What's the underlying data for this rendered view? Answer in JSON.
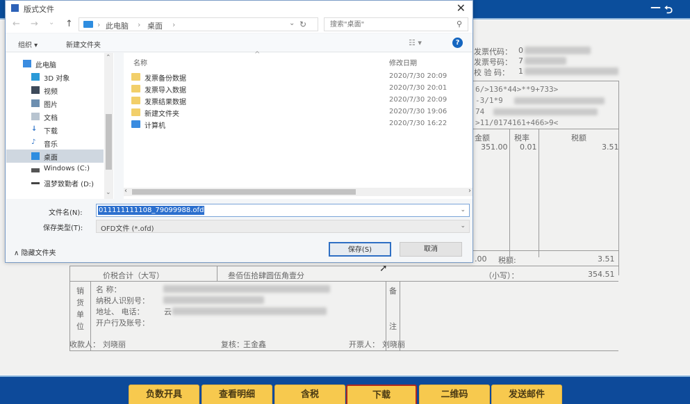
{
  "app": {
    "window_controls": {
      "minimize": "—",
      "back": "⮌"
    },
    "bottom_buttons": [
      {
        "label": "负数开具",
        "active": false
      },
      {
        "label": "查看明细",
        "active": false
      },
      {
        "label": "含税",
        "active": false
      },
      {
        "label": "下载",
        "active": true
      },
      {
        "label": "二维码",
        "active": false
      },
      {
        "label": "发送邮件",
        "active": false
      }
    ],
    "colors": {
      "topbar": "#0b4e9c",
      "button": "#f7c94e",
      "active_border": "#b0281e"
    }
  },
  "invoice": {
    "code_label": "发票代码：",
    "code_value": "0",
    "number_label": "发票号码：",
    "number_value": "7",
    "check_label": "校 验 码：",
    "check_value": "1",
    "cipher_lines": [
      "6/>136*44>**9+733>",
      "-3/1*9",
      "74",
      ">11/0174161+466>9<"
    ],
    "table_headers": {
      "amount": "金额",
      "rate": "税率",
      "tax": "税额"
    },
    "row": {
      "amount": "351.00",
      "rate": "0.01",
      "tax": "3.51"
    },
    "total_amount_partial": ".00",
    "total_tax_label": "税额:",
    "total_tax": "3.51",
    "grand_total_label": "价税合计（大写）",
    "grand_total_words": "叁佰伍拾肆圆伍角壹分",
    "small_label": "（小写）：",
    "grand_total": "354.51",
    "seller_side_label": [
      "销",
      "货",
      "单",
      "位"
    ],
    "seller_fields": [
      "名        称：",
      "纳税人识别号：",
      "地址、  电话：",
      "开户行及账号："
    ],
    "seller_address_visible": "云",
    "remarks_label": [
      "备",
      "注"
    ],
    "payee_label": "收款人：",
    "payee": "刘晓丽",
    "reviewer_label": "复核：",
    "reviewer": "王金鑫",
    "issuer_label": "开票人：",
    "issuer": "刘晓丽"
  },
  "dialog": {
    "title": "版式文件",
    "close": "✕",
    "nav": {
      "back": "←",
      "forward": "→",
      "recent": "⌄",
      "up": "↑"
    },
    "breadcrumb": [
      "此电脑",
      "桌面"
    ],
    "search_placeholder": "搜索\"桌面\"",
    "toolbar": {
      "organize": "组织 ▾",
      "new_folder": "新建文件夹",
      "view": "☷ ▾",
      "help": "?"
    },
    "nav_items": [
      {
        "label": "此电脑",
        "icon": "computer-icon"
      },
      {
        "label": "3D 对象",
        "icon": "3d-objects-icon"
      },
      {
        "label": "视频",
        "icon": "video-icon"
      },
      {
        "label": "图片",
        "icon": "pictures-icon"
      },
      {
        "label": "文档",
        "icon": "documents-icon"
      },
      {
        "label": "下载",
        "icon": "download-icon"
      },
      {
        "label": "音乐",
        "icon": "music-icon"
      },
      {
        "label": "桌面",
        "icon": "desktop-icon",
        "selected": true
      },
      {
        "label": "Windows (C:)",
        "icon": "drive-icon"
      },
      {
        "label": "温梦致勤者 (D:)",
        "icon": "drive-icon"
      }
    ],
    "columns": {
      "name": "名称",
      "modified": "修改日期"
    },
    "files": [
      {
        "name": "发票备份数据",
        "date": "2020/7/30 20:09",
        "type": "folder"
      },
      {
        "name": "发票导入数据",
        "date": "2020/7/30 20:01",
        "type": "folder"
      },
      {
        "name": "发票结果数据",
        "date": "2020/7/30 20:09",
        "type": "folder"
      },
      {
        "name": "新建文件夹",
        "date": "2020/7/30 19:06",
        "type": "folder"
      },
      {
        "name": "计算机",
        "date": "2020/7/30 16:22",
        "type": "shortcut"
      }
    ],
    "filename_label": "文件名(N):",
    "filename_value": "011111111108_79099988.ofd",
    "filetype_label": "保存类型(T):",
    "filetype_value": "OFD文件 (*.ofd)",
    "hide_folders": "∧  隐藏文件夹",
    "save_button": "保存(S)",
    "cancel_button": "取消"
  }
}
